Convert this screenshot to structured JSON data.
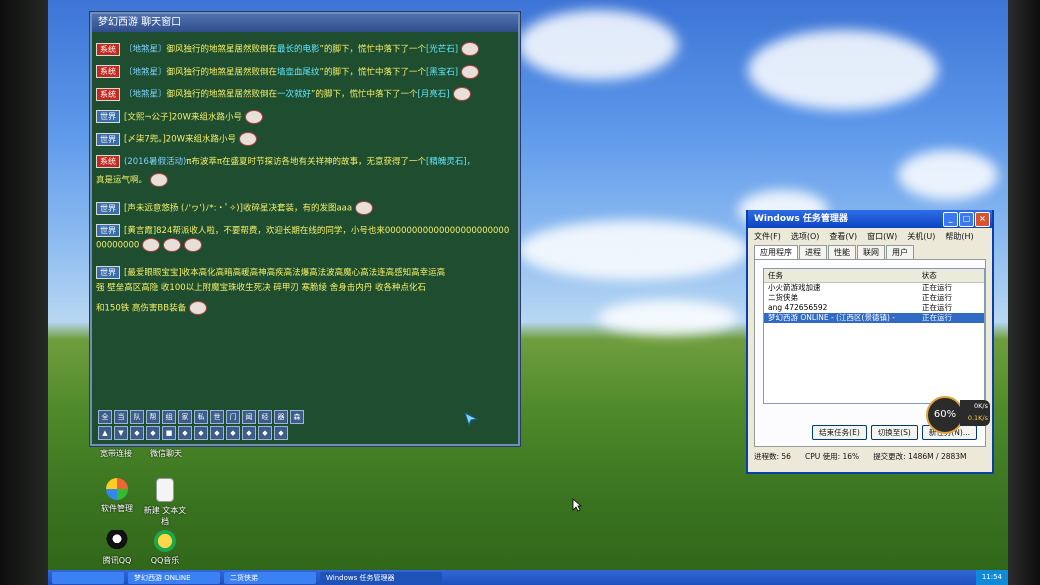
{
  "chat": {
    "title": "梦幻西游  聊天窗口",
    "messages": [
      {
        "tag": "系统",
        "kind": "sys",
        "name": "〔地煞星〕",
        "text": "御风独行的地煞星居然败倒在",
        "hl": "最长的电影",
        "text2": "”的脚下，慌忙中落下了一个",
        "item": "[光芒石]"
      },
      {
        "tag": "系统",
        "kind": "sys",
        "name": "〔地煞星〕",
        "text": "御风独行的地煞星居然败倒在",
        "hl": "墙壶血尾纹",
        "text2": "”的脚下，慌忙中落下了一个",
        "item": "[黑宝石]"
      },
      {
        "tag": "系统",
        "kind": "sys",
        "name": "〔地煞星〕",
        "text": "御风独行的地煞星居然败倒在",
        "hl": "一次就好",
        "text2": "”的脚下，慌忙中落下了一个",
        "item": "[月亮石]"
      },
      {
        "tag": "世界",
        "kind": "world",
        "name": "",
        "text": "[文熙¬公子]20W来组水路小号",
        "hl": "",
        "text2": "",
        "item": ""
      },
      {
        "tag": "世界",
        "kind": "world",
        "name": "",
        "text": "[〆柒7兜。]20W来组水路小号",
        "hl": "",
        "text2": "",
        "item": ""
      },
      {
        "tag": "系统",
        "kind": "sys",
        "name": "(2016暑假活动)",
        "text": "π布波萃π在盛夏时节探访各地有关祥神的故事，无意获得了一个",
        "hl": "",
        "text2": "",
        "item": "[精魄灵石]，"
      },
      {
        "tag": "",
        "kind": "cont",
        "name": "",
        "text": "真是运气啊。",
        "hl": "",
        "text2": "",
        "item": ""
      },
      {
        "tag": "世界",
        "kind": "world",
        "name": "",
        "text": "[声未远意悠扬 (ﾉ'ヮ')ﾉ*:・ﾟ✧)]收碎星决套装，有的发图aaa",
        "hl": "",
        "text2": "",
        "item": ""
      },
      {
        "tag": "世界",
        "kind": "world",
        "name": "",
        "text": "[黄言霞]824帮派收人啦，不要帮费，欢迎长期在线的同学，小号也来0000000000000000000000000000000",
        "hl": "",
        "text2": "",
        "item": ""
      },
      {
        "tag": "世界",
        "kind": "world",
        "name": "",
        "text": "[最爱眼眼宝宝]收本高化高暗高暖高神高疾高法爆高法波高魔心高法连高感知高幸运高",
        "hl": "",
        "text2": "",
        "item": ""
      },
      {
        "tag": "",
        "kind": "cont",
        "name": "",
        "text": "强  壁垒高区高隐  收100以上附魔宝珠收生死决 碎甲刃 寒脆绫 舍身击内丹 收各种点化石",
        "hl": "",
        "text2": "",
        "item": ""
      },
      {
        "tag": "",
        "kind": "cont",
        "name": "",
        "text": "和150铁  高伤害BB装备",
        "hl": "",
        "text2": "",
        "item": ""
      }
    ],
    "toolbar_row1": [
      "全",
      "当",
      "队",
      "帮",
      "组",
      "家",
      "私",
      "世",
      "门",
      "闻",
      "经",
      "器",
      "森"
    ],
    "toolbar_row2": [
      "▲",
      "▼",
      "◆",
      "◆",
      "■",
      "◆",
      "◆",
      "◆",
      "◆",
      "◆",
      "◆",
      "◆"
    ]
  },
  "desktop": {
    "label_broadband": "宽带连接",
    "label_wechat": "微信聊天",
    "icons": [
      {
        "label": "软件管理"
      },
      {
        "label": "新建  文本文档"
      },
      {
        "label": "腾讯QQ"
      },
      {
        "label": "QQ音乐"
      }
    ]
  },
  "taskmgr": {
    "title": "Windows 任务管理器",
    "menu": [
      "文件(F)",
      "选项(O)",
      "查看(V)",
      "窗口(W)",
      "关机(U)",
      "帮助(H)"
    ],
    "tabs": [
      "应用程序",
      "进程",
      "性能",
      "联网",
      "用户"
    ],
    "col_task": "任务",
    "col_status": "状态",
    "rows": [
      {
        "task": "小火箭游戏加速",
        "status": "正在运行"
      },
      {
        "task": "二货侠弟",
        "status": "正在运行"
      },
      {
        "task": "ang 472656592",
        "status": "正在运行"
      },
      {
        "task": "梦幻西游 ONLINE - (江西区(景德镇) -",
        "status": "正在运行"
      }
    ],
    "btn_end": "结束任务(E)",
    "btn_switch": "切换至(S)",
    "btn_new": "新任务(N)...",
    "status_procs": "进程数: 56",
    "status_cpu": "CPU 使用: 16%",
    "status_mem": "提交更改: 1486M / 2883M"
  },
  "gauge": {
    "value": "60%",
    "up": "0K/s",
    "down": "0.1K/s"
  },
  "taskbar": {
    "tasks": [
      "",
      "梦幻西游 ONLINE",
      "二货侠弟",
      "Windows 任务管理器"
    ],
    "clock": "11:54"
  }
}
